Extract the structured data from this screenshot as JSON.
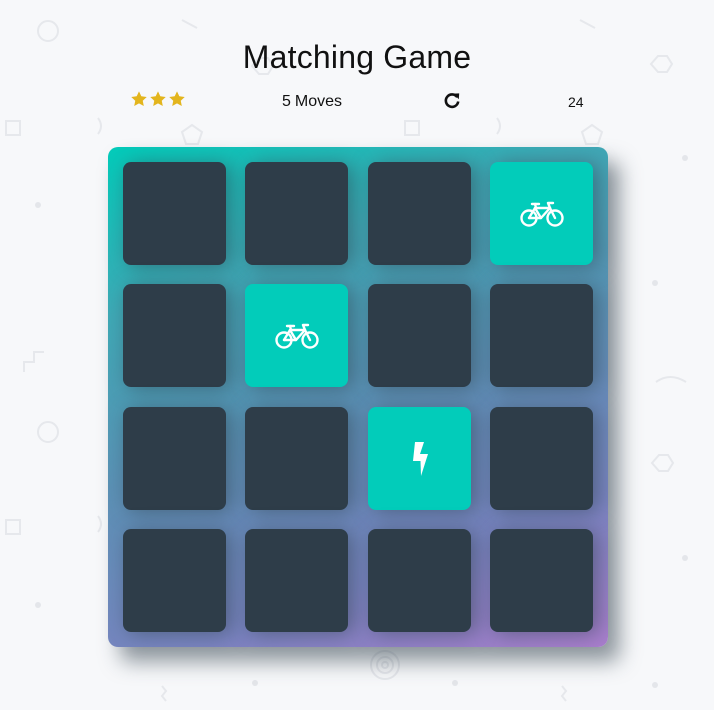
{
  "header": {
    "title": "Matching Game"
  },
  "score_panel": {
    "star_rating": 3,
    "star_color": "#e3b51d",
    "moves_count": "5",
    "moves_label": "Moves",
    "restart_icon": "restart-icon",
    "timer": "24"
  },
  "colors": {
    "card_back": "#2e3d49",
    "card_open": "#02ccba",
    "deck_gradient_start": "#02ccba",
    "deck_gradient_end": "#aa7ecd",
    "page_background": "#f7f8fa"
  },
  "deck": {
    "rows": 4,
    "columns": 4,
    "cards": [
      {
        "row": 1,
        "col": 1,
        "state": "closed",
        "icon": ""
      },
      {
        "row": 1,
        "col": 2,
        "state": "closed",
        "icon": ""
      },
      {
        "row": 1,
        "col": 3,
        "state": "closed",
        "icon": ""
      },
      {
        "row": 1,
        "col": 4,
        "state": "open",
        "icon": "bicycle-icon"
      },
      {
        "row": 2,
        "col": 1,
        "state": "closed",
        "icon": ""
      },
      {
        "row": 2,
        "col": 2,
        "state": "open",
        "icon": "bicycle-icon"
      },
      {
        "row": 2,
        "col": 3,
        "state": "closed",
        "icon": ""
      },
      {
        "row": 2,
        "col": 4,
        "state": "closed",
        "icon": ""
      },
      {
        "row": 3,
        "col": 1,
        "state": "closed",
        "icon": ""
      },
      {
        "row": 3,
        "col": 2,
        "state": "closed",
        "icon": ""
      },
      {
        "row": 3,
        "col": 3,
        "state": "open",
        "icon": "bolt-icon"
      },
      {
        "row": 3,
        "col": 4,
        "state": "closed",
        "icon": ""
      },
      {
        "row": 4,
        "col": 1,
        "state": "closed",
        "icon": ""
      },
      {
        "row": 4,
        "col": 2,
        "state": "closed",
        "icon": ""
      },
      {
        "row": 4,
        "col": 3,
        "state": "closed",
        "icon": ""
      },
      {
        "row": 4,
        "col": 4,
        "state": "closed",
        "icon": ""
      }
    ]
  }
}
